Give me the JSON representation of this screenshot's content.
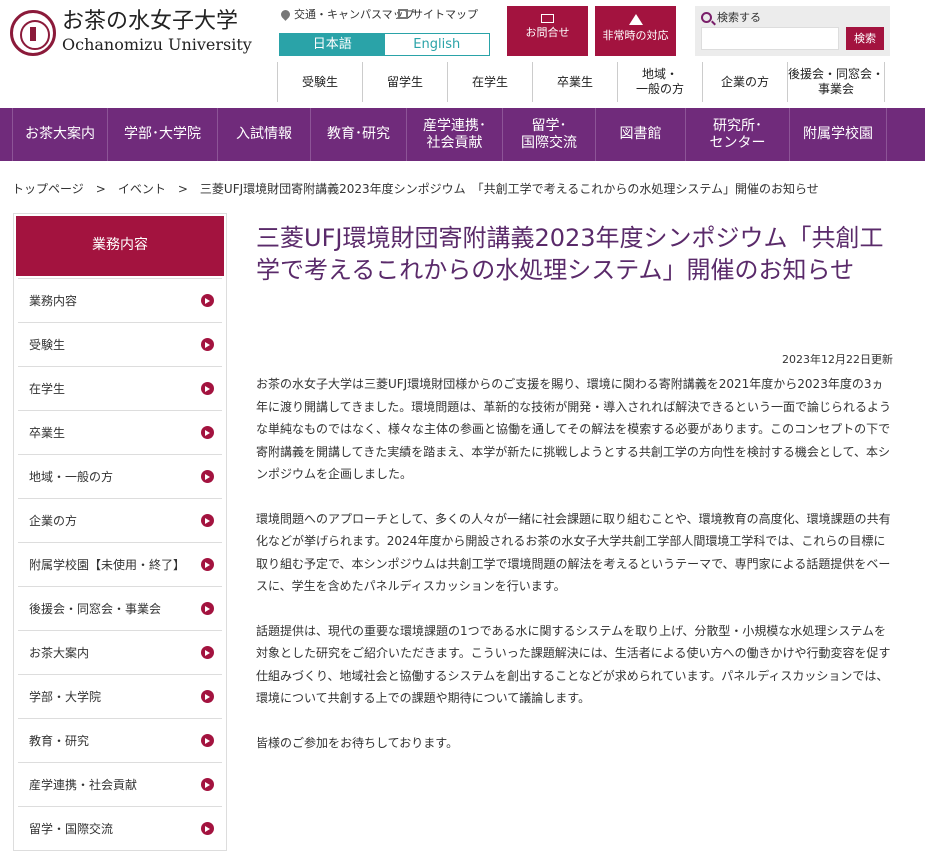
{
  "header": {
    "logo_ja": "お茶の水女子大学",
    "logo_en": "Ochanomizu University",
    "access_link": "交通・キャンパスマップ",
    "sitemap_link": "サイトマップ",
    "lang_ja": "日本語",
    "lang_en": "English",
    "contact_label": "お問合せ",
    "emergency_label": "非常時の対応",
    "search_label": "検索する",
    "search_placeholder": "",
    "search_button": "検索"
  },
  "audience_nav": [
    "受験生",
    "留学生",
    "在学生",
    "卒業生",
    "地域・\n一般の方",
    "企業の方",
    "後援会・同窓会・\n事業会"
  ],
  "main_nav": [
    "お茶大案内",
    "学部･大学院",
    "入試情報",
    "教育･研究",
    "産学連携･\n社会貢献",
    "留学･\n国際交流",
    "図書館",
    "研究所･\nセンター",
    "附属学校園"
  ],
  "breadcrumb": {
    "items": [
      "トップページ",
      "イベント",
      "三菱UFJ環境財団寄附講義2023年度シンポジウム　「共創工学で考えるこれからの水処理システム」開催のお知らせ"
    ],
    "separator": ">"
  },
  "sidebar": {
    "heading": "業務内容",
    "items": [
      "業務内容",
      "受験生",
      "在学生",
      "卒業生",
      "地域・一般の方",
      "企業の方",
      "附属学校園【未使用・終了】",
      "後援会・同窓会・事業会",
      "お茶大案内",
      "学部・大学院",
      "教育・研究",
      "産学連携・社会貢献",
      "留学・国際交流"
    ]
  },
  "article": {
    "title": "三菱UFJ環境財団寄附講義2023年度シンポジウム「共創工学で考えるこれからの水処理システム」開催のお知らせ",
    "updated": "2023年12月22日更新",
    "paragraphs": [
      "お茶の水女子大学は三菱UFJ環境財団様からのご支援を賜り、環境に関わる寄附講義を2021年度から2023年度の3ヵ年に渡り開講してきました。環境問題は、革新的な技術が開発・導入されれば解決できるという一面で論じられるような単純なものではなく、様々な主体の参画と協働を通してその解法を模索する必要があります。このコンセプトの下で寄附講義を開講してきた実績を踏まえ、本学が新たに挑戦しようとする共創工学の方向性を検討する機会として、本シンポジウムを企画しました。",
      "環境問題へのアプローチとして、多くの人々が一緒に社会課題に取り組むことや、環境教育の高度化、環境課題の共有化などが挙げられます。2024年度から開設されるお茶の水女子大学共創工学部人間環境工学科では、これらの目標に取り組む予定で、本シンポジウムは共創工学で環境問題の解法を考えるというテーマで、専門家による話題提供をベースに、学生を含めたパネルディスカッションを行います。",
      "話題提供は、現代の重要な環境課題の1つである水に関するシステムを取り上げ、分散型・小規模な水処理システムを対象とした研究をご紹介いただきます。こういった課題解決には、生活者による使い方への働きかけや行動変容を促す仕組みづくり、地域社会と協働するシステムを創出することなどが求められています。パネルディスカッションでは、環境について共創する上での課題や期待について議論します。",
      "皆様のご参加をお待ちしております。"
    ]
  },
  "colors": {
    "brand_purple": "#702b7b",
    "accent_crimson": "#a3133f",
    "lang_teal": "#2aa3a8",
    "title_purple": "#5a2a6a"
  },
  "icons": {
    "logo": "university-seal",
    "access": "map-pin-icon",
    "sitemap": "sitemap-icon",
    "contact": "mail-icon",
    "emergency": "warning-icon",
    "search": "magnifier-icon",
    "sidebar_arrow": "chevron-right-circle-icon"
  }
}
